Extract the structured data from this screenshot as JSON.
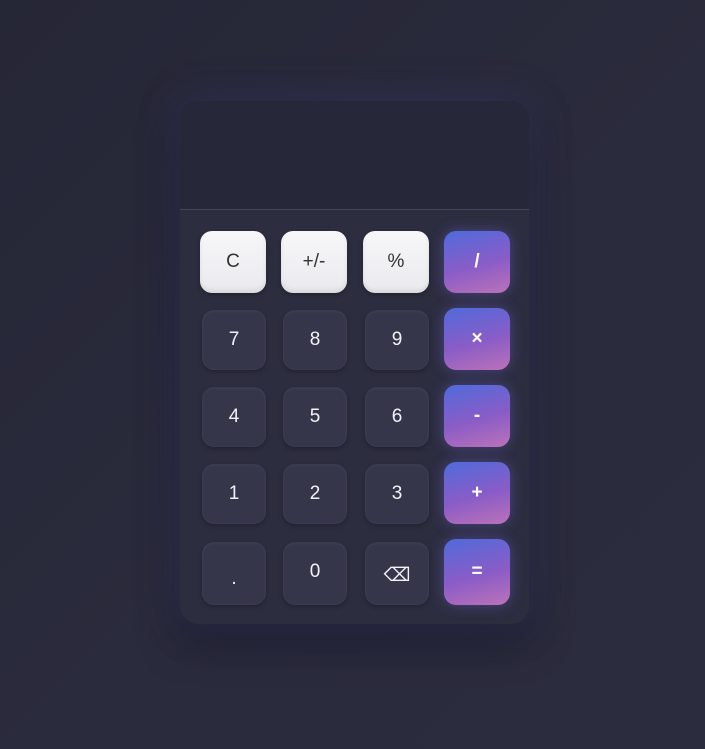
{
  "display": {
    "value": ""
  },
  "keys": {
    "clear": "C",
    "sign": "+/-",
    "percent": "%",
    "divide": "/",
    "seven": "7",
    "eight": "8",
    "nine": "9",
    "multiply": "×",
    "four": "4",
    "five": "5",
    "six": "6",
    "subtract": "-",
    "one": "1",
    "two": "2",
    "three": "3",
    "add": "+",
    "decimal": ".",
    "zero": "0",
    "backspace": "⌫",
    "equals": "="
  },
  "colors": {
    "background": "#272838",
    "calculator": "#2c2d3f",
    "display": "#262738",
    "number_key": "#35364a",
    "function_key": "#f2f2f4",
    "operator_gradient_start": "#4f6bdb",
    "operator_gradient_end": "#bb72b8"
  }
}
